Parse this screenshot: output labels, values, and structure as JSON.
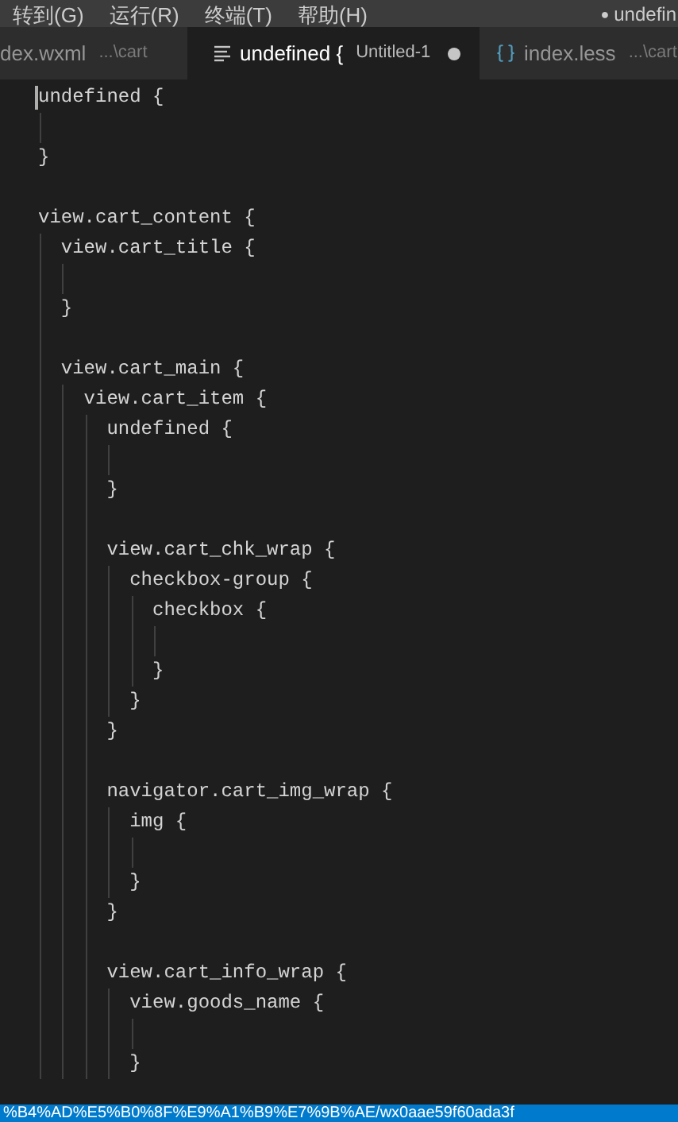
{
  "menu": [
    "转到(G)",
    "运行(R)",
    "终端(T)",
    "帮助(H)"
  ],
  "window_title": {
    "dot": "●",
    "text": "undefin"
  },
  "tabs": [
    {
      "name": "dex.wxml",
      "path": "...\\cart",
      "kind": "xml",
      "selected": false
    },
    {
      "name": "undefined {",
      "path": "Untitled-1",
      "kind": "text",
      "selected": true,
      "modified": true
    },
    {
      "name": "index.less",
      "path": "...\\cart",
      "kind": "less",
      "selected": false
    }
  ],
  "code_lines": [
    {
      "kind": "code",
      "text": "undefined {",
      "cursor": true
    },
    {
      "kind": "blank"
    },
    {
      "kind": "code",
      "text": "}"
    },
    {
      "kind": "blank"
    },
    {
      "kind": "code",
      "text": "view.cart_content {"
    },
    {
      "kind": "code",
      "text": "  view.cart_title {"
    },
    {
      "kind": "blank"
    },
    {
      "kind": "code",
      "text": "  }"
    },
    {
      "kind": "blank"
    },
    {
      "kind": "code",
      "text": "  view.cart_main {"
    },
    {
      "kind": "code",
      "text": "    view.cart_item {"
    },
    {
      "kind": "code",
      "text": "      undefined {"
    },
    {
      "kind": "blank"
    },
    {
      "kind": "code",
      "text": "      }"
    },
    {
      "kind": "blank"
    },
    {
      "kind": "code",
      "text": "      view.cart_chk_wrap {"
    },
    {
      "kind": "code",
      "text": "        checkbox-group {"
    },
    {
      "kind": "code",
      "text": "          checkbox {"
    },
    {
      "kind": "blank"
    },
    {
      "kind": "code",
      "text": "          }"
    },
    {
      "kind": "code",
      "text": "        }"
    },
    {
      "kind": "code",
      "text": "      }"
    },
    {
      "kind": "blank"
    },
    {
      "kind": "code",
      "text": "      navigator.cart_img_wrap {"
    },
    {
      "kind": "code",
      "text": "        img {"
    },
    {
      "kind": "blank"
    },
    {
      "kind": "code",
      "text": "        }"
    },
    {
      "kind": "code",
      "text": "      }"
    },
    {
      "kind": "blank"
    },
    {
      "kind": "code",
      "text": "      view.cart_info_wrap {"
    },
    {
      "kind": "code",
      "text": "        view.goods_name {"
    },
    {
      "kind": "blank"
    },
    {
      "kind": "code",
      "text": "        }"
    }
  ],
  "status_bar": "%B4%AD%E5%B0%8F%E9%A1%B9%E7%9B%AE/wx0aae59f60ada3f"
}
